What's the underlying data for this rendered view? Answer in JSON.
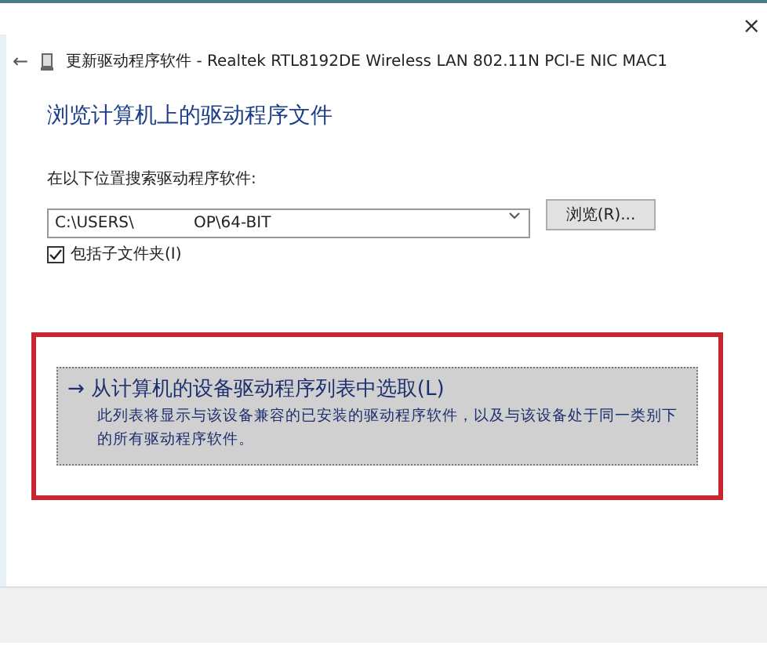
{
  "window": {
    "title": "更新驱动程序软件 - Realtek RTL8192DE Wireless LAN 802.11N PCI-E NIC MAC1",
    "close": "×",
    "back": "←"
  },
  "heading": "浏览计算机上的驱动程序文件",
  "search_label": "在以下位置搜索驱动程序软件:",
  "path_field": {
    "value": "C:\\USERS\\            OP\\64-BIT"
  },
  "browse_button": "浏览(R)...",
  "include_subfolders": {
    "label": "包括子文件夹(I)",
    "checked": true
  },
  "pick_option": {
    "arrow": "→",
    "title": "从计算机的设备驱动程序列表中选取(L)",
    "description": "此列表将显示与该设备兼容的已安装的驱动程序软件，以及与该设备处于同一类别下的所有驱动程序软件。",
    "highlighted": true
  }
}
